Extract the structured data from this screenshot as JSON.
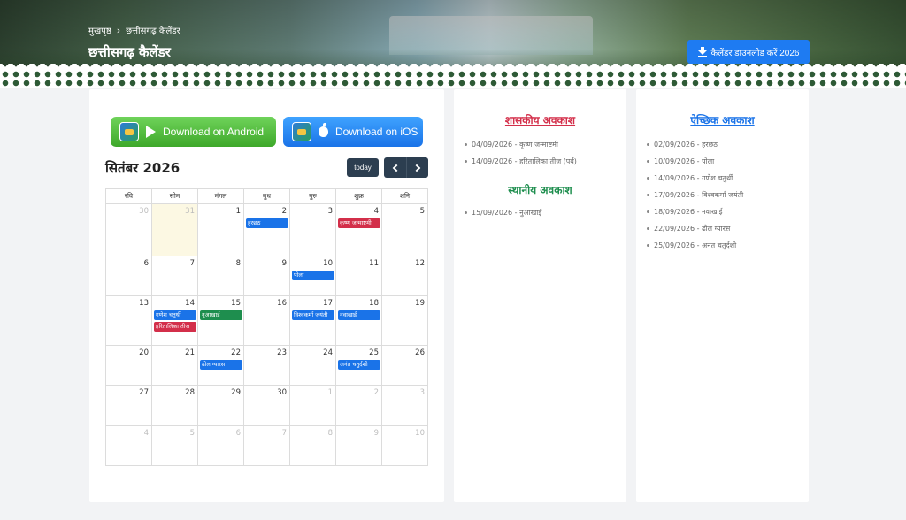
{
  "header": {
    "breadcrumb": [
      "मुखपृष्ठ",
      "छत्तीसगढ़ कैलेंडर"
    ],
    "breadcrumb_sep": "›",
    "title": "छत्तीसगढ़ कैलेंडर",
    "download_label": "कैलेंडर डाउनलोड करें 2026"
  },
  "apps": {
    "android_label": "Download on Android",
    "ios_label": "Download on iOS"
  },
  "calendar": {
    "month_title": "सितंबर 2026",
    "today_label": "today",
    "weekdays": [
      "रवि",
      "सोम",
      "मंगल",
      "बुध",
      "गुरु",
      "शुक्र",
      "शनि"
    ],
    "weeks": [
      [
        {
          "d": "30",
          "other": true
        },
        {
          "d": "31",
          "other": true,
          "today": true
        },
        {
          "d": "1"
        },
        {
          "d": "2",
          "events": [
            {
              "t": "हरछठ",
              "c": "#1a73e8"
            }
          ]
        },
        {
          "d": "3"
        },
        {
          "d": "4",
          "events": [
            {
              "t": "कृष्ण जन्माष्टमी",
              "c": "#d32f4a"
            }
          ]
        },
        {
          "d": "5"
        }
      ],
      [
        {
          "d": "6"
        },
        {
          "d": "7"
        },
        {
          "d": "8"
        },
        {
          "d": "9"
        },
        {
          "d": "10",
          "events": [
            {
              "t": "पोला",
              "c": "#1a73e8"
            }
          ]
        },
        {
          "d": "11"
        },
        {
          "d": "12"
        }
      ],
      [
        {
          "d": "13"
        },
        {
          "d": "14",
          "events": [
            {
              "t": "गणेश चतुर्थी",
              "c": "#1a73e8"
            },
            {
              "t": "हरितालिका तीज",
              "c": "#d32f4a"
            }
          ]
        },
        {
          "d": "15",
          "events": [
            {
              "t": "नुआखाई",
              "c": "#1e8e4e"
            }
          ]
        },
        {
          "d": "16"
        },
        {
          "d": "17",
          "events": [
            {
              "t": "विश्वकर्मा जयंती",
              "c": "#1a73e8"
            }
          ]
        },
        {
          "d": "18",
          "events": [
            {
              "t": "नवाखाई",
              "c": "#1a73e8"
            }
          ]
        },
        {
          "d": "19"
        }
      ],
      [
        {
          "d": "20"
        },
        {
          "d": "21"
        },
        {
          "d": "22",
          "events": [
            {
              "t": "ढोल ग्यारस",
              "c": "#1a73e8"
            }
          ]
        },
        {
          "d": "23"
        },
        {
          "d": "24"
        },
        {
          "d": "25",
          "events": [
            {
              "t": "अनंत चतुर्दशी",
              "c": "#1a73e8"
            }
          ]
        },
        {
          "d": "26"
        }
      ],
      [
        {
          "d": "27"
        },
        {
          "d": "28"
        },
        {
          "d": "29"
        },
        {
          "d": "30"
        },
        {
          "d": "1",
          "other": true
        },
        {
          "d": "2",
          "other": true
        },
        {
          "d": "3",
          "other": true
        }
      ],
      [
        {
          "d": "4",
          "other": true
        },
        {
          "d": "5",
          "other": true
        },
        {
          "d": "6",
          "other": true
        },
        {
          "d": "7",
          "other": true
        },
        {
          "d": "8",
          "other": true
        },
        {
          "d": "9",
          "other": true
        },
        {
          "d": "10",
          "other": true
        }
      ]
    ]
  },
  "gov_holidays": {
    "title": "शासकीय अवकाश",
    "color": "#d32f4a",
    "items": [
      "04/09/2026 - कृष्ण जन्माष्टमी",
      "14/09/2026 - हरितालिका तीज (पर्व)"
    ]
  },
  "local_holidays": {
    "title": "स्थानीय अवकाश",
    "color": "#1e8e4e",
    "items": [
      "15/09/2026 - नुआखाई"
    ]
  },
  "optional_holidays": {
    "title": "ऐच्छिक अवकाश",
    "color": "#1a73e8",
    "items": [
      "02/09/2026 - हरछठ",
      "10/09/2026 - पोला",
      "14/09/2026 - गणेश चतुर्थी",
      "17/09/2026 - विश्वकर्मा जयंती",
      "18/09/2026 - नवाखाई",
      "22/09/2026 - ढोल ग्यारस",
      "25/09/2026 - अनंत चतुर्दशी"
    ]
  }
}
